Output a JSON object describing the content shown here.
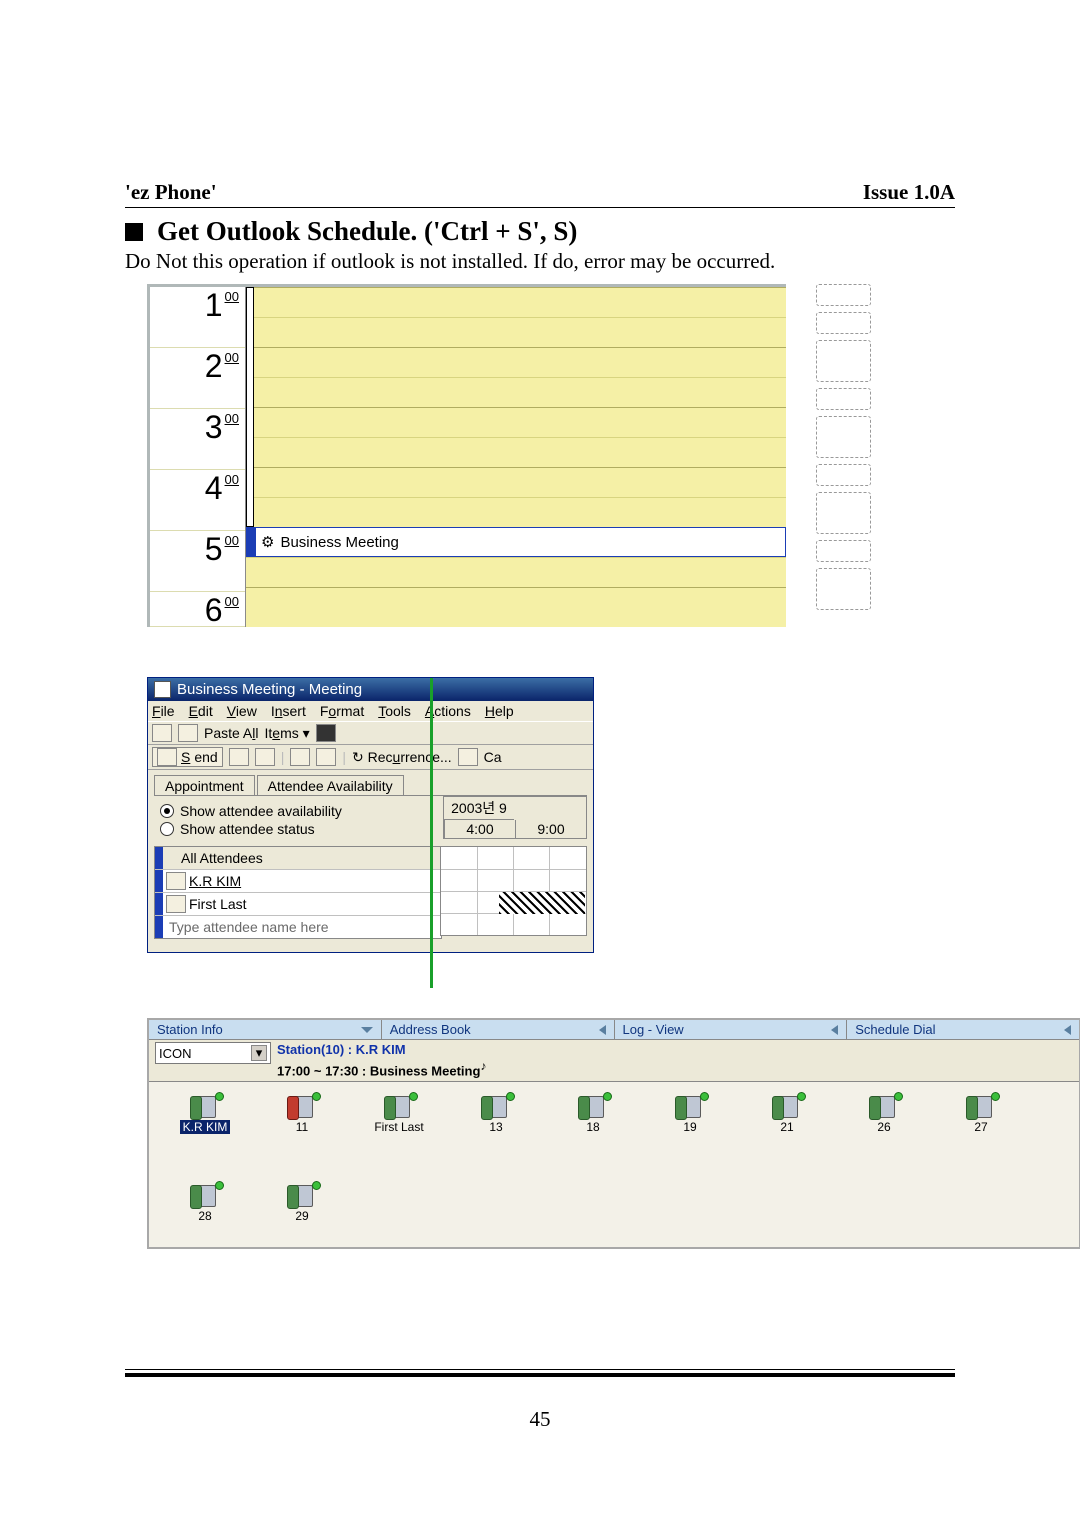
{
  "header": {
    "left": "'ez Phone'",
    "right": "Issue 1.0A"
  },
  "section": {
    "title": "Get Outlook Schedule. ('Ctrl + S', S)"
  },
  "body_text": "Do Not this operation if outlook is not installed. If do, error may be occurred.",
  "calendar": {
    "hours": [
      "1",
      "2",
      "3",
      "4",
      "5",
      "6"
    ],
    "minute_label": "00",
    "appointment": "Business Meeting"
  },
  "meeting": {
    "title": "Business Meeting - Meeting",
    "menu": [
      "File",
      "Edit",
      "View",
      "Insert",
      "Format",
      "Tools",
      "Actions",
      "Help"
    ],
    "menu_ul": [
      "F",
      "E",
      "V",
      "n",
      "o",
      "T",
      "A",
      "H"
    ],
    "toolbar1": {
      "paste_all": "Paste All",
      "items": "Items"
    },
    "toolbar2": {
      "send": "Send",
      "recurrence": "Recurrence...",
      "ca": "Ca"
    },
    "tabs": {
      "appointment": "Appointment",
      "attendee": "Attendee Availability"
    },
    "radio_avail": "Show attendee availability",
    "radio_status": "Show attendee status",
    "time_header": {
      "date": "2003년 9",
      "t1": "4:00",
      "t2": "9:00"
    },
    "attendees_header": "All Attendees",
    "attendees": [
      "K.R KIM",
      "First Last"
    ],
    "attendee_placeholder": "Type attendee name here"
  },
  "ezpanel": {
    "tabs": [
      "Station Info",
      "Address Book",
      "Log - View",
      "Schedule Dial"
    ],
    "selector": "ICON",
    "station_line": "Station(10) :  K.R KIM",
    "sched_line": "17:00 ~ 17:30 : Business Meeting",
    "sched_note": "♪",
    "icons": [
      {
        "label": "K.R KIM",
        "sel": true,
        "busy": false
      },
      {
        "label": "11",
        "sel": false,
        "busy": true
      },
      {
        "label": "First Last",
        "sel": false,
        "busy": false
      },
      {
        "label": "13",
        "sel": false,
        "busy": false
      },
      {
        "label": "18",
        "sel": false,
        "busy": false
      },
      {
        "label": "19",
        "sel": false,
        "busy": false
      },
      {
        "label": "21",
        "sel": false,
        "busy": false
      },
      {
        "label": "26",
        "sel": false,
        "busy": false
      },
      {
        "label": "27",
        "sel": false,
        "busy": false
      },
      {
        "label": "28",
        "sel": false,
        "busy": false
      },
      {
        "label": "29",
        "sel": false,
        "busy": false
      }
    ]
  },
  "page_number": "45"
}
